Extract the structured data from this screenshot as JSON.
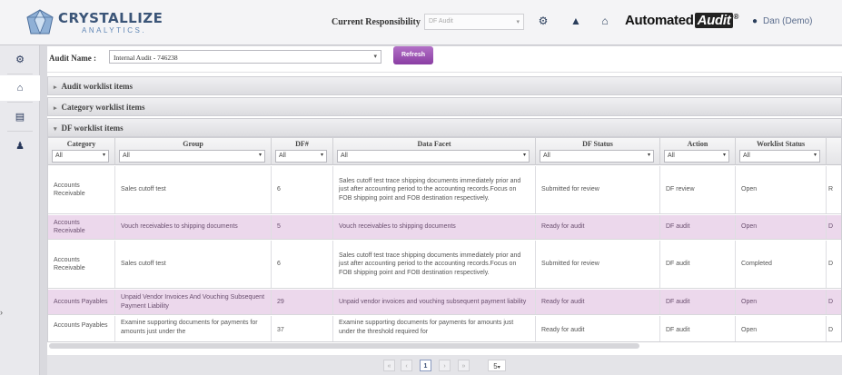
{
  "app": {
    "logo_name": "CRYSTALLIZE",
    "logo_sub": "ANALYTICS.",
    "current_responsibility_label": "Current Responsibility",
    "current_responsibility_value": "DF Audit",
    "brand_text": "Automated",
    "brand_badge": "Audit",
    "brand_mark": "®",
    "user_name": "Dan (Demo)"
  },
  "icons": {
    "gear": "gear-icon",
    "bell": "bell-icon",
    "home": "home-icon",
    "user": "user-icon",
    "document": "document-icon"
  },
  "toolbar": {
    "audit_name_label": "Audit Name :",
    "audit_name_value": "Internal Audit - 746238",
    "refresh_label": "Refresh"
  },
  "sections": [
    {
      "label": "Audit worklist items",
      "expanded": false
    },
    {
      "label": "Category worklist items",
      "expanded": false
    },
    {
      "label": "DF worklist items",
      "expanded": true
    }
  ],
  "grid": {
    "columns": [
      {
        "header": "Category",
        "filter": "All"
      },
      {
        "header": "Group",
        "filter": "All"
      },
      {
        "header": "DF#",
        "filter": "All"
      },
      {
        "header": "Data Facet",
        "filter": "All"
      },
      {
        "header": "DF Status",
        "filter": "All"
      },
      {
        "header": "Action",
        "filter": "All"
      },
      {
        "header": "Worklist Status",
        "filter": "All"
      },
      {
        "header": "",
        "filter": ""
      }
    ],
    "rows": [
      {
        "category": "Accounts Receivable",
        "group": "Sales cutoff test",
        "df": "6",
        "facet": "Sales cutoff test trace shipping documents immediately prior and just after accounting period to the accounting records.Focus on FOB shipping point and FOB destination respectively.",
        "status": "Submitted for review",
        "action": "DF review",
        "worklist": "Open",
        "extra": "R"
      },
      {
        "category": "Accounts Receivable",
        "group": "Vouch receivables to shipping documents",
        "df": "5",
        "facet": "Vouch receivables to shipping documents",
        "status": "Ready for audit",
        "action": "DF audit",
        "worklist": "Open",
        "extra": "D"
      },
      {
        "category": "Accounts Receivable",
        "group": "Sales cutoff test",
        "df": "6",
        "facet": "Sales cutoff test trace shipping documents immediately prior and just after accounting period to the accounting records.Focus on FOB shipping point and FOB destination respectively.",
        "status": "Submitted for review",
        "action": "DF audit",
        "worklist": "Completed",
        "extra": "D"
      },
      {
        "category": "Accounts Payables",
        "group": "Unpaid Vendor Invoices And Vouching Subsequent Payment Liability",
        "df": "29",
        "facet": "Unpaid vendor invoices and vouching subsequent payment liability",
        "status": "Ready for audit",
        "action": "DF audit",
        "worklist": "Open",
        "extra": "D"
      },
      {
        "category": "Accounts Payables",
        "group": "Examine supporting documents for payments for amounts just under the",
        "df": "37",
        "facet": "Examine supporting documents for payments for amounts just under the threshold required for",
        "status": "Ready for audit",
        "action": "DF audit",
        "worklist": "Open",
        "extra": "D"
      }
    ]
  },
  "pager": {
    "first": "«",
    "prev": "‹",
    "current_page": "1",
    "next": "›",
    "last": "»",
    "page_size": "5"
  },
  "colors": {
    "accent": "#9a4db3",
    "highlight_row": "#ecd8ec",
    "navy": "#27375a"
  }
}
